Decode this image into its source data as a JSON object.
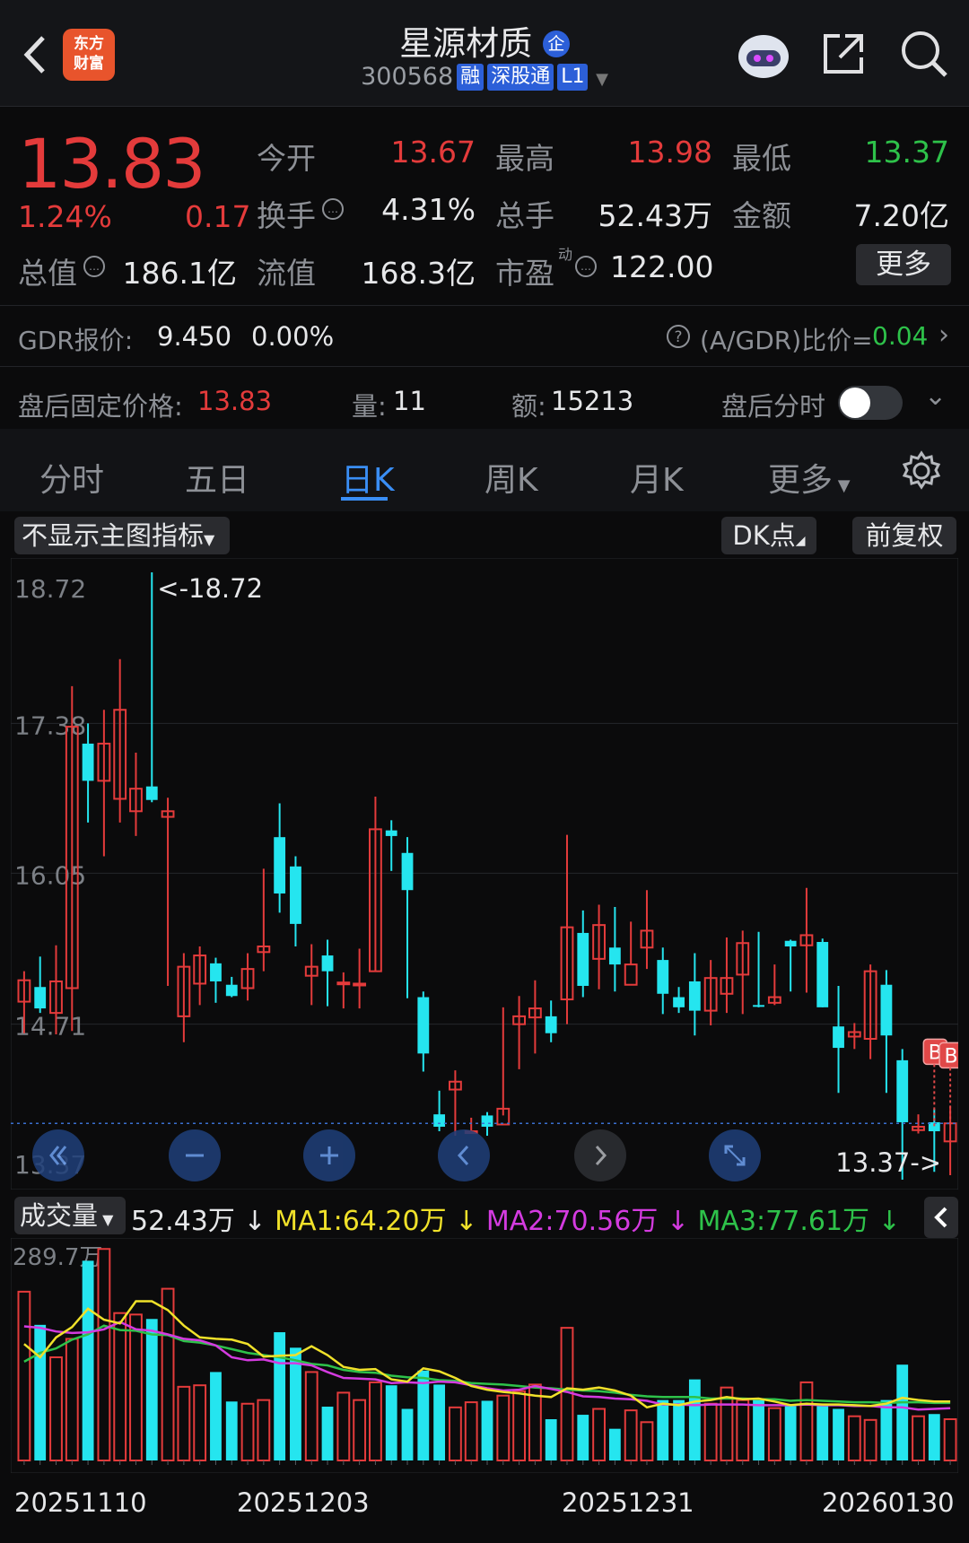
{
  "header": {
    "logo_line1": "东方",
    "logo_line2": "财富",
    "stock_name": "星源材质",
    "name_badge": "企",
    "code": "300568",
    "tags": [
      "融",
      "深股通",
      "L1"
    ]
  },
  "quote": {
    "price": "13.83",
    "change_pct": "1.24%",
    "change": "0.17",
    "open_label": "今开",
    "open": "13.67",
    "high_label": "最高",
    "high": "13.98",
    "low_label": "最低",
    "low": "13.37",
    "turnover_label": "换手",
    "turnover": "4.31%",
    "volume_label": "总手",
    "volume": "52.43万",
    "amount_label": "金额",
    "amount": "7.20亿",
    "mktcap_label": "总值",
    "mktcap": "186.1亿",
    "float_label": "流值",
    "float": "168.3亿",
    "pe_label": "市盈",
    "pe_sup": "动",
    "pe": "122.00",
    "more_button": "更多"
  },
  "gdr": {
    "label": "GDR报价:",
    "price": "9.450",
    "change": "0.00%",
    "ratio_label": "(A/GDR)比价=",
    "ratio": "0.04"
  },
  "afterhours": {
    "label": "盘后固定价格:",
    "price": "13.83",
    "vol_label": "量:",
    "vol": "11",
    "amt_label": "额:",
    "amt": "15213",
    "toggle_label": "盘后分时"
  },
  "tabs": [
    "分时",
    "五日",
    "日K",
    "周K",
    "月K",
    "更多"
  ],
  "active_tab": "日K",
  "chart_toolbar": {
    "indicator": "不显示主图指标",
    "dk": "DK点",
    "adjust": "前复权"
  },
  "chart_data": [
    {
      "type": "candlestick",
      "ylim": [
        13.37,
        18.72
      ],
      "y_ticks": [
        "18.72",
        "17.38",
        "16.05",
        "14.71",
        "13.37"
      ],
      "max_label": "<-18.72",
      "min_label": "13.37->",
      "marker_labels": [
        "B",
        "B"
      ],
      "candles": [
        [
          14.91,
          15.1,
          15.18,
          14.63
        ],
        [
          15.04,
          14.85,
          15.31,
          14.81
        ],
        [
          14.81,
          15.09,
          15.41,
          14.62
        ],
        [
          15.03,
          17.35,
          17.71,
          14.65
        ],
        [
          17.2,
          16.87,
          17.38,
          16.5
        ],
        [
          16.87,
          17.2,
          17.5,
          16.2
        ],
        [
          16.71,
          17.5,
          17.95,
          16.5
        ],
        [
          16.6,
          16.8,
          17.12,
          16.38
        ],
        [
          16.82,
          16.7,
          18.72,
          16.68
        ],
        [
          16.55,
          16.6,
          16.72,
          15.05
        ],
        [
          14.78,
          15.22,
          15.34,
          14.55
        ],
        [
          15.07,
          15.32,
          15.4,
          14.88
        ],
        [
          15.25,
          15.09,
          15.3,
          14.9
        ],
        [
          15.06,
          14.96,
          15.13,
          14.95
        ],
        [
          15.03,
          15.2,
          15.34,
          14.92
        ],
        [
          15.35,
          15.4,
          16.09,
          15.18
        ],
        [
          16.37,
          15.87,
          16.67,
          15.7
        ],
        [
          16.11,
          15.6,
          16.2,
          15.4
        ],
        [
          15.14,
          15.22,
          15.42,
          14.88
        ],
        [
          15.32,
          15.18,
          15.46,
          14.87
        ],
        [
          15.07,
          15.08,
          15.17,
          14.85
        ],
        [
          15.06,
          15.07,
          15.38,
          14.85
        ],
        [
          15.18,
          16.44,
          16.73,
          15.18
        ],
        [
          16.43,
          16.38,
          16.52,
          16.07
        ],
        [
          16.23,
          15.9,
          16.37,
          14.94
        ],
        [
          14.95,
          14.45,
          15.0,
          14.29
        ],
        [
          13.91,
          13.8,
          14.12,
          13.76
        ],
        [
          14.13,
          14.2,
          14.3,
          13.72
        ],
        [
          13.76,
          13.76,
          13.88,
          13.75
        ],
        [
          13.9,
          13.8,
          13.93,
          13.72
        ],
        [
          13.82,
          13.96,
          14.86,
          13.9
        ],
        [
          14.71,
          14.78,
          14.96,
          14.31
        ],
        [
          14.77,
          14.85,
          15.1,
          14.45
        ],
        [
          14.78,
          14.63,
          14.92,
          14.55
        ],
        [
          14.93,
          15.57,
          16.39,
          14.71
        ],
        [
          15.52,
          15.05,
          15.72,
          14.95
        ],
        [
          15.29,
          15.59,
          15.77,
          15.02
        ],
        [
          15.39,
          15.24,
          15.75,
          15.0
        ],
        [
          15.06,
          15.24,
          15.62,
          15.24
        ],
        [
          15.39,
          15.54,
          15.9,
          15.2
        ],
        [
          15.28,
          14.98,
          15.39,
          14.8
        ],
        [
          14.95,
          14.86,
          15.04,
          14.81
        ],
        [
          15.09,
          14.83,
          15.34,
          14.61
        ],
        [
          14.83,
          15.12,
          15.28,
          14.7
        ],
        [
          14.98,
          15.12,
          15.48,
          14.81
        ],
        [
          15.15,
          15.43,
          15.54,
          14.8
        ],
        [
          14.88,
          14.87,
          15.53,
          14.86
        ],
        [
          14.9,
          14.95,
          15.24,
          14.88
        ],
        [
          15.45,
          15.4,
          15.46,
          15.0
        ],
        [
          15.41,
          15.5,
          15.92,
          14.99
        ],
        [
          15.44,
          14.86,
          15.47,
          14.86
        ],
        [
          14.69,
          14.5,
          15.05,
          14.1
        ],
        [
          14.6,
          14.64,
          14.72,
          14.49
        ],
        [
          14.58,
          15.18,
          15.24,
          14.4
        ],
        [
          15.06,
          14.61,
          15.19,
          14.1
        ],
        [
          14.39,
          13.84,
          14.49,
          13.33
        ],
        [
          13.77,
          13.8,
          13.91,
          13.74
        ],
        [
          13.84,
          13.76,
          13.96,
          13.4
        ],
        [
          13.67,
          13.83,
          13.98,
          13.37
        ]
      ]
    },
    {
      "type": "bar",
      "series_label": "成交量",
      "value_label": "52.43万",
      "ma": [
        {
          "name": "MA1",
          "value": "64.20万",
          "color": "#f0e12a"
        },
        {
          "name": "MA2",
          "value": "70.56万",
          "color": "#d43be0"
        },
        {
          "name": "MA3",
          "value": "77.61万",
          "color": "#2ec24a"
        }
      ],
      "ymax_label": "289.7万",
      "x_ticks": [
        "20251110",
        "20251203",
        "20251231",
        "20260130"
      ],
      "values": [
        229,
        184,
        140,
        165,
        271,
        287,
        200,
        198,
        192,
        233,
        100,
        102,
        120,
        80,
        77,
        82,
        174,
        153,
        120,
        73,
        92,
        82,
        106,
        102,
        70,
        122,
        103,
        72,
        79,
        81,
        88,
        94,
        103,
        56,
        180,
        62,
        70,
        43,
        68,
        52,
        82,
        82,
        110,
        77,
        99,
        82,
        82,
        71,
        74,
        106,
        74,
        70,
        60,
        55,
        82,
        130,
        60,
        63,
        56
      ],
      "ma1": [
        158,
        140,
        167,
        181,
        206,
        191,
        186,
        216,
        216,
        204,
        183,
        167,
        165,
        164,
        158,
        141,
        142,
        143,
        155,
        143,
        127,
        123,
        124,
        110,
        107,
        125,
        121,
        112,
        101,
        96,
        93,
        91,
        88,
        86,
        98,
        96,
        99,
        95,
        88,
        72,
        77,
        75,
        80,
        82,
        86,
        83,
        84,
        80,
        75,
        77,
        76,
        76,
        75,
        74,
        77,
        85,
        82,
        80,
        80
      ],
      "ma2": [
        182,
        180,
        175,
        173,
        174,
        178,
        188,
        178,
        176,
        171,
        165,
        163,
        156,
        140,
        136,
        137,
        132,
        132,
        129,
        120,
        112,
        111,
        110,
        105,
        106,
        105,
        107,
        106,
        102,
        98,
        95,
        96,
        101,
        97,
        93,
        87,
        86,
        84,
        83,
        81,
        76,
        76,
        75,
        76,
        76,
        76,
        75,
        75,
        75,
        76,
        75,
        75,
        74,
        74,
        72,
        72,
        69,
        70,
        71
      ],
      "ma3": [
        134,
        146,
        152,
        164,
        171,
        183,
        177,
        176,
        171,
        170,
        162,
        160,
        156,
        151,
        146,
        143,
        140,
        136,
        131,
        129,
        123,
        120,
        119,
        115,
        113,
        112,
        109,
        108,
        105,
        104,
        103,
        101,
        99,
        98,
        96,
        95,
        94,
        92,
        89,
        87,
        86,
        86,
        86,
        84,
        84,
        84,
        83,
        83,
        81,
        82,
        81,
        80,
        79,
        79,
        78,
        79,
        79,
        78,
        78
      ]
    }
  ],
  "colors": {
    "up": "#e43b3b",
    "down": "#25e5ef",
    "bg": "#0b0b0c",
    "accent_blue": "#3a8ef5"
  }
}
